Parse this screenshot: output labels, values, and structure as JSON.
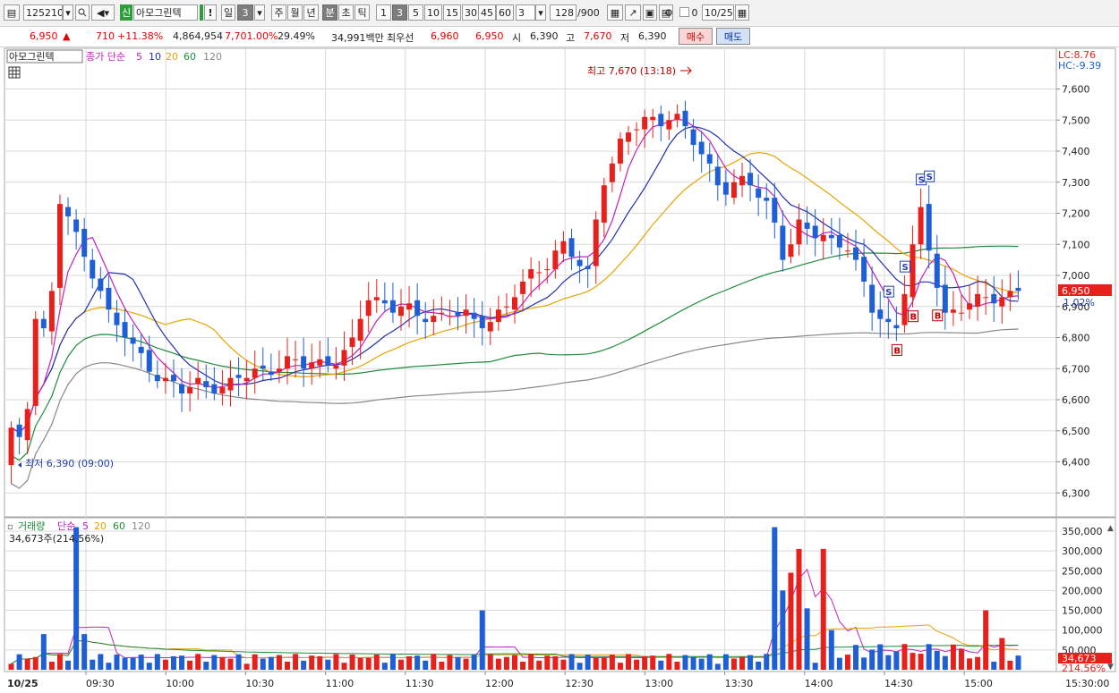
{
  "toolbar": {
    "code": "125210",
    "badge": "신",
    "stock_name": "아모그린텍",
    "warn": "!",
    "period_day": "일",
    "period_count": "3",
    "periods": [
      "주",
      "월",
      "년",
      "분",
      "초",
      "틱"
    ],
    "intervals": [
      "1",
      "3",
      "5",
      "10",
      "15",
      "30",
      "45",
      "60"
    ],
    "interval_value": "3",
    "count": "128",
    "count_total": "/900",
    "zero": "0",
    "date": "10/25"
  },
  "quote": {
    "price": "6,950",
    "arrow": "▲",
    "change": "710",
    "change_pct": "+11.38%",
    "volume": "4,864,954",
    "turnover_pct": "7,701.00%",
    "ratio": "29.49%",
    "amount": "34,991백만",
    "best_label": "최우선",
    "best_ask": "6,960",
    "best_bid": "6,950",
    "open_label": "시",
    "open": "6,390",
    "high_label": "고",
    "high": "7,670",
    "low_label": "저",
    "low": "6,390",
    "buy_label": "매수",
    "sell_label": "매도"
  },
  "colors": {
    "up": "#e8201c",
    "down": "#1f5fd6",
    "ma5": "#c020c0",
    "ma10": "#2030b0",
    "ma20": "#e8a400",
    "ma60": "#1e8a3a",
    "ma120": "#888888",
    "grid": "#d9d9d9"
  },
  "price_panel": {
    "legend_name": "아모그린텍",
    "legend_prefix": "종가 단순",
    "ma_labels": [
      "5",
      "10",
      "20",
      "60",
      "120"
    ],
    "lc": "LC:8.76",
    "hc": "HC:-9.39",
    "y_ticks": [
      "7,600",
      "7,500",
      "7,400",
      "7,300",
      "7,200",
      "7,100",
      "7,000",
      "6,900",
      "6,800",
      "6,700",
      "6,600",
      "6,500",
      "6,400",
      "6,300"
    ],
    "current_price_label": "6,950",
    "current_pct_label": "1.02%",
    "high_annotation": "최고 7,670 (13:18)",
    "low_annotation": "최저 6,390 (09:00)",
    "signals": [
      "S",
      "B",
      "S",
      "B",
      "S",
      "S",
      "B"
    ]
  },
  "volume_panel": {
    "legend_prefix": "거래량",
    "legend_ma": "단순",
    "ma_labels": [
      "5",
      "20",
      "60",
      "120"
    ],
    "info": "34,673주(214.56%)",
    "y_ticks": [
      "350,000",
      "300,000",
      "250,000",
      "200,000",
      "150,000",
      "100,000",
      "50,000"
    ],
    "current_volume_label": "34,673",
    "current_pct_label": "214.56%"
  },
  "x_axis": {
    "date_label": "10/25",
    "times": [
      "09:30",
      "10:00",
      "10:30",
      "11:00",
      "11:30",
      "12:00",
      "12:30",
      "13:00",
      "13:30",
      "14:00",
      "14:30",
      "15:00"
    ],
    "end_label": "15:30:00"
  }
}
